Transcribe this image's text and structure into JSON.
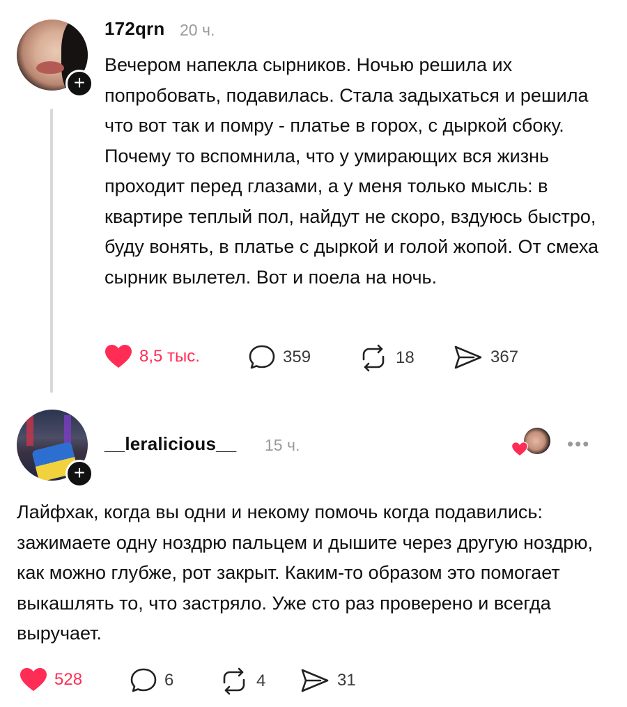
{
  "post": {
    "username": "172qrn",
    "time": "20 ч.",
    "text": "Вечером напекла сырников. Ночью решила их попробовать, подавилась. Стала задыхаться и решила что вот так и помру - платье в горох, с дыркой сбоку. Почему то вспомнила, что у умирающих вся жизнь проходит перед глазами, а у меня только мысль: в квартире теплый пол, найдут не скоро, вздуюсь быстро, буду вонять, в платье с дыркой и голой жопой. От смеха сырник вылетел. Вот и поела на ночь.",
    "likes": "8,5 тыс.",
    "comments": "359",
    "reposts": "18",
    "shares": "367",
    "colors": {
      "liked": "#ff2d55"
    }
  },
  "reply": {
    "username": "__leralicious__",
    "time": "15 ч.",
    "more_label": "•••",
    "text": "Лайфхак, когда вы одни и некому помочь когда подавились: зажимаете одну ноздрю пальцем и дышите через другую ноздрю, как можно глубже, рот закрыт. Каким-то образом это помогает выкашлять то, что застряло. Уже сто раз проверено и всегда выручает.",
    "likes": "528",
    "comments": "6",
    "reposts": "4",
    "shares": "31"
  },
  "icons": {
    "follow": "plus-icon",
    "like": "heart-icon",
    "comment": "comment-bubble-icon",
    "repost": "repost-icon",
    "share": "send-icon",
    "more": "more-dots-icon"
  }
}
